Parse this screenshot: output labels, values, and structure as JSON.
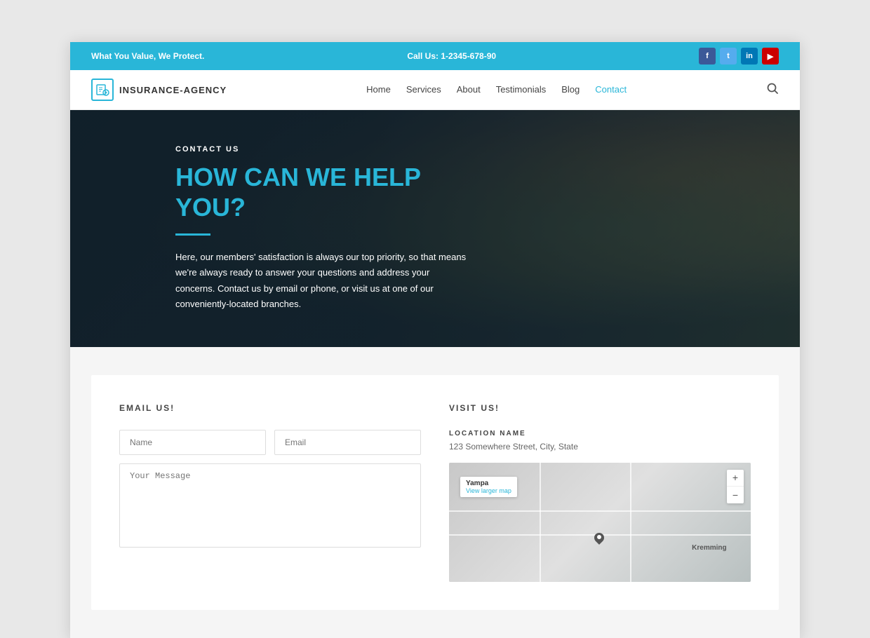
{
  "topbar": {
    "tagline": "What You Value, We Protect.",
    "phone_label": "Call Us: 1-2345-678-90",
    "social": [
      {
        "name": "facebook",
        "label": "f"
      },
      {
        "name": "twitter",
        "label": "t"
      },
      {
        "name": "linkedin",
        "label": "in"
      },
      {
        "name": "youtube",
        "label": "▶"
      }
    ]
  },
  "nav": {
    "logo_text": "INSURANCE-AGENCY",
    "links": [
      {
        "label": "Home",
        "active": false
      },
      {
        "label": "Services",
        "active": false
      },
      {
        "label": "About",
        "active": false
      },
      {
        "label": "Testimonials",
        "active": false
      },
      {
        "label": "Blog",
        "active": false
      },
      {
        "label": "Contact",
        "active": true
      }
    ]
  },
  "hero": {
    "label": "CONTACT US",
    "title": "HOW CAN WE HELP YOU?",
    "description": "Here, our members' satisfaction is always our top priority, so that means we're always ready to answer your questions and address your concerns. Contact us by email or phone, or visit us at one of our conveniently-located branches."
  },
  "email_section": {
    "title": "EMAIL US!",
    "name_placeholder": "Name",
    "email_placeholder": "Email",
    "message_placeholder": "Your Message"
  },
  "visit_section": {
    "title": "VISIT US!",
    "location_label": "LOCATION NAME",
    "address": "123 Somewhere Street, City, State",
    "map": {
      "town": "Yampa",
      "link_text": "View larger map",
      "town2": "Kremming",
      "zoom_in": "+",
      "zoom_out": "−"
    }
  }
}
